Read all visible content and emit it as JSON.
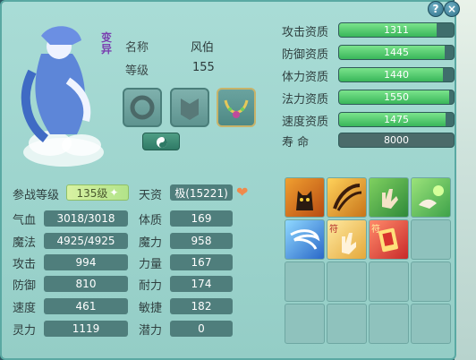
{
  "window": {
    "help_label": "?",
    "close_label": "×"
  },
  "pet": {
    "badge": "变异",
    "name_label": "名称",
    "name": "风伯",
    "level_label": "等级",
    "level": "155"
  },
  "aptitudes": [
    {
      "label": "攻击资质",
      "value": "1311",
      "fill": 0.85
    },
    {
      "label": "防御资质",
      "value": "1445",
      "fill": 0.92
    },
    {
      "label": "体力资质",
      "value": "1440",
      "fill": 0.91
    },
    {
      "label": "法力资质",
      "value": "1550",
      "fill": 0.96
    },
    {
      "label": "速度资质",
      "value": "1475",
      "fill": 0.93
    }
  ],
  "life": {
    "label": "寿    命",
    "value": "8000"
  },
  "stats_left": [
    {
      "label": "参战等级",
      "value": "135级"
    },
    {
      "label": "气血",
      "value": "3018/3018"
    },
    {
      "label": "魔法",
      "value": "4925/4925"
    },
    {
      "label": "攻击",
      "value": "994"
    },
    {
      "label": "防御",
      "value": "810"
    },
    {
      "label": "速度",
      "value": "461"
    },
    {
      "label": "灵力",
      "value": "1119"
    }
  ],
  "stats_right": [
    {
      "label": "天资",
      "value": "极(15221)"
    },
    {
      "label": "体质",
      "value": "169"
    },
    {
      "label": "魔力",
      "value": "958"
    },
    {
      "label": "力量",
      "value": "167"
    },
    {
      "label": "耐力",
      "value": "174"
    },
    {
      "label": "敏捷",
      "value": "182"
    },
    {
      "label": "潜力",
      "value": "0"
    }
  ],
  "skills": {
    "row2_marks": [
      "符",
      "符"
    ],
    "icons": [
      "cat-skill-icon",
      "claw-skill-icon",
      "palm-skill-icon",
      "green-hand-skill-icon",
      "whirlwind-skill-icon",
      "talisman-palm-skill-icon",
      "talisman-card-skill-icon"
    ]
  },
  "colors": {
    "aptitude_fill": "#39b65a",
    "panel_bg": "#a9dcd6",
    "stat_box": "#4f7e7c"
  }
}
